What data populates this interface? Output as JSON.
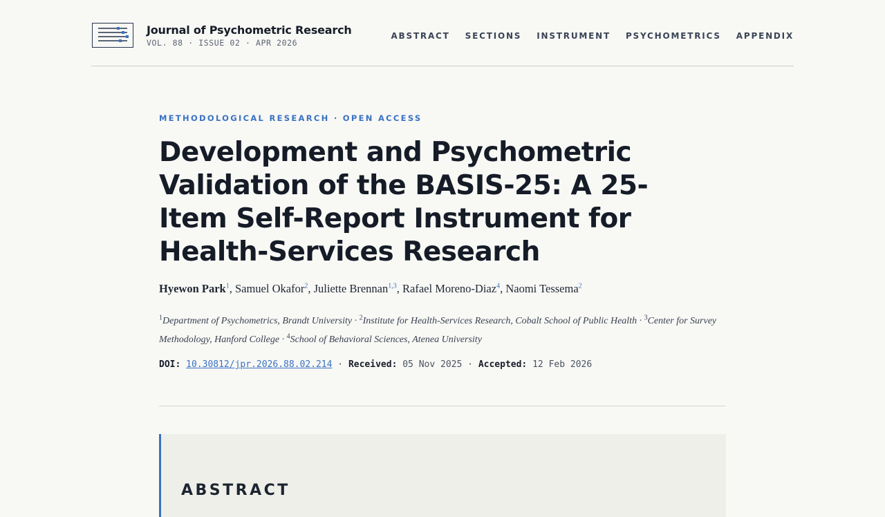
{
  "journal": {
    "name": "Journal of Psychometric Research",
    "issue_line": "VOL. 88 · ISSUE 02 · APR 2026",
    "logo_icon": "journal-logo-icon"
  },
  "nav": {
    "items": [
      "ABSTRACT",
      "SECTIONS",
      "INSTRUMENT",
      "PSYCHOMETRICS",
      "APPENDIX"
    ]
  },
  "article": {
    "kicker": "METHODOLOGICAL RESEARCH · OPEN ACCESS",
    "title": "Development and Psychometric Validation of the BASIS-25: A 25-Item Self-Report Instrument for Health-Services Research",
    "authors": [
      {
        "name": "Hyewon Park",
        "sup": "1"
      },
      {
        "name": "Samuel Okafor",
        "sup": "2"
      },
      {
        "name": "Juliette Brennan",
        "sup": "1,3"
      },
      {
        "name": "Rafael Moreno-Diaz",
        "sup": "4"
      },
      {
        "name": "Naomi Tessema",
        "sup": "2"
      }
    ],
    "affiliations": [
      {
        "num": "1",
        "text": "Department of Psychometrics, Brandt University"
      },
      {
        "num": "2",
        "text": "Institute for Health-Services Research, Cobalt School of Public Health"
      },
      {
        "num": "3",
        "text": "Center for Survey Methodology, Hanford College"
      },
      {
        "num": "4",
        "text": "School of Behavioral Sciences, Atenea University"
      }
    ],
    "doi_label": "DOI:",
    "doi": "10.30812/jpr.2026.88.02.214",
    "received_label": "Received:",
    "received": "05 Nov 2025",
    "accepted_label": "Accepted:",
    "accepted": "12 Feb 2026"
  },
  "abstract": {
    "heading": "ABSTRACT"
  },
  "colors": {
    "accent": "#3a72c2",
    "text": "#161d28",
    "background": "#f8f8f5",
    "abstract_bg": "#efefea"
  }
}
